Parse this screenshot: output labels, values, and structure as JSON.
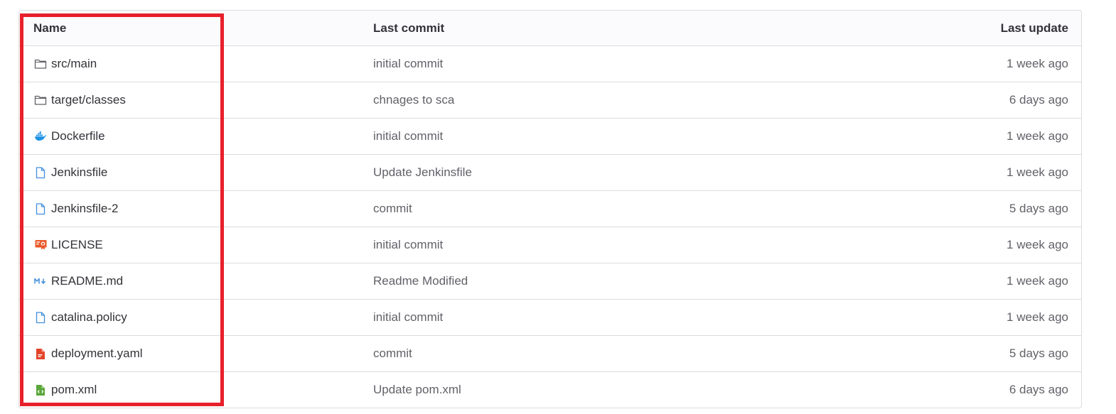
{
  "table": {
    "headers": {
      "name": "Name",
      "last_commit": "Last commit",
      "last_update": "Last update"
    },
    "rows": [
      {
        "name": "src/main",
        "icon": "folder-icon",
        "commit": "initial commit",
        "updated": "1 week ago"
      },
      {
        "name": "target/classes",
        "icon": "folder-icon",
        "commit": "chnages to sca",
        "updated": "6 days ago"
      },
      {
        "name": "Dockerfile",
        "icon": "docker-icon",
        "commit": "initial commit",
        "updated": "1 week ago"
      },
      {
        "name": "Jenkinsfile",
        "icon": "file-icon",
        "commit": "Update Jenkinsfile",
        "updated": "1 week ago"
      },
      {
        "name": "Jenkinsfile-2",
        "icon": "file-icon",
        "commit": "commit",
        "updated": "5 days ago"
      },
      {
        "name": "LICENSE",
        "icon": "license-icon",
        "commit": "initial commit",
        "updated": "1 week ago"
      },
      {
        "name": "README.md",
        "icon": "markdown-icon",
        "commit": "Readme Modified",
        "updated": "1 week ago"
      },
      {
        "name": "catalina.policy",
        "icon": "file-icon",
        "commit": "initial commit",
        "updated": "1 week ago"
      },
      {
        "name": "deployment.yaml",
        "icon": "yaml-icon",
        "commit": "commit",
        "updated": "5 days ago"
      },
      {
        "name": "pom.xml",
        "icon": "xml-icon",
        "commit": "Update pom.xml",
        "updated": "6 days ago"
      }
    ]
  },
  "colors": {
    "highlight": "#e8202b",
    "folder": "#626168",
    "file": "#1f75cb",
    "docker": "#1d91e6",
    "license": "#e9592a",
    "markdown": "#428fdc",
    "yaml": "#e24329",
    "xml": "#5ba63b"
  }
}
